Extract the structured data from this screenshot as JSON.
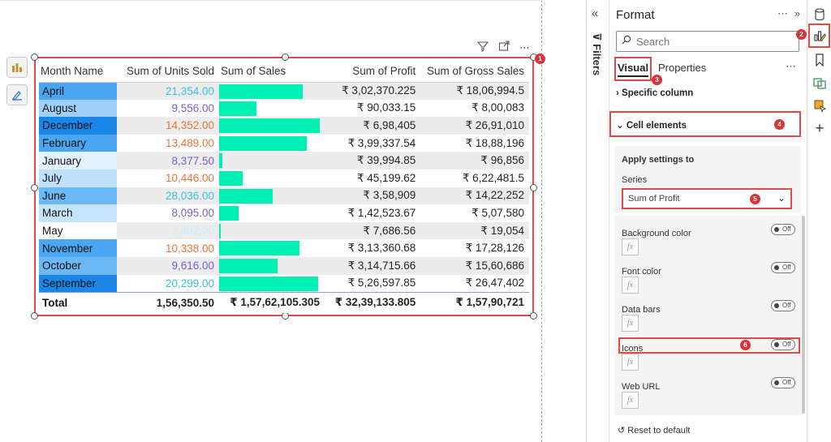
{
  "table": {
    "headers": [
      "Month Name",
      "Sum of Units Sold",
      "Sum of Sales",
      "Sum of Profit",
      "Sum of Gross Sales"
    ],
    "rows": [
      {
        "month": "April",
        "units": "21,354.00",
        "units_color": "#3ac1e8",
        "sales_fraction": 0.83,
        "profit": "₹ 3,02,370.225",
        "gross": "₹ 18,06,994.5",
        "month_bg": "#4aa6f0"
      },
      {
        "month": "August",
        "units": "9,556.00",
        "units_color": "#7a5fd1",
        "sales_fraction": 0.37,
        "profit": "₹ 90,033.15",
        "gross": "₹ 8,00,083",
        "month_bg": "#9fd0fb"
      },
      {
        "month": "December",
        "units": "14,352.00",
        "units_color": "#e8763a",
        "sales_fraction": 1.0,
        "profit": "₹ 6,98,405",
        "gross": "₹ 26,91,010",
        "month_bg": "#1a86e8"
      },
      {
        "month": "February",
        "units": "13,489.00",
        "units_color": "#e8763a",
        "sales_fraction": 0.87,
        "profit": "₹ 3,99,337.54",
        "gross": "₹ 18,88,196",
        "month_bg": "#4aa6f0"
      },
      {
        "month": "January",
        "units": "8,377.50",
        "units_color": "#7a5fd1",
        "sales_fraction": 0.03,
        "profit": "₹ 39,994.85",
        "gross": "₹ 96,856",
        "month_bg": "#e4f2fe"
      },
      {
        "month": "July",
        "units": "10,446.00",
        "units_color": "#e8763a",
        "sales_fraction": 0.23,
        "profit": "₹ 45,199.62",
        "gross": "₹ 6,22,481.5",
        "month_bg": "#bfe0fc"
      },
      {
        "month": "June",
        "units": "28,036.00",
        "units_color": "#3ac1e8",
        "sales_fraction": 0.53,
        "profit": "₹ 3,58,909",
        "gross": "₹ 14,22,252",
        "month_bg": "#6cb8f4"
      },
      {
        "month": "March",
        "units": "8,095.00",
        "units_color": "#7a5fd1",
        "sales_fraction": 0.19,
        "profit": "₹ 1,42,523.67",
        "gross": "₹ 5,07,580",
        "month_bg": "#c6e3fc"
      },
      {
        "month": "May",
        "units": "2,392.00",
        "units_color": "#c9ecf8",
        "sales_fraction": 0.02,
        "profit": "₹ 7,686.56",
        "gross": "₹ 19,054",
        "month_bg": "#ffffff"
      },
      {
        "month": "November",
        "units": "10,338.00",
        "units_color": "#e8763a",
        "sales_fraction": 0.8,
        "profit": "₹ 3,13,360.68",
        "gross": "₹ 17,28,126",
        "month_bg": "#4aa6f0"
      },
      {
        "month": "October",
        "units": "9,616.00",
        "units_color": "#7a5fd1",
        "sales_fraction": 0.58,
        "profit": "₹ 3,14,715.66",
        "gross": "₹ 15,60,686",
        "month_bg": "#6cb8f4"
      },
      {
        "month": "September",
        "units": "20,299.00",
        "units_color": "#3ac1e8",
        "sales_fraction": 0.98,
        "profit": "₹ 5,26,597.85",
        "gross": "₹ 26,47,402",
        "month_bg": "#1a86e8"
      }
    ],
    "total": {
      "label": "Total",
      "units": "1,56,350.50",
      "sales": "₹ 1,57,62,105.305",
      "profit": "₹ 32,39,133.805",
      "gross": "₹ 1,57,90,721"
    }
  },
  "filters_label": "Filters",
  "format": {
    "title": "Format",
    "search_placeholder": "Search",
    "tab_visual": "Visual",
    "tab_properties": "Properties",
    "specific_column": "Specific column",
    "cell_elements": "Cell elements",
    "apply_settings_to": "Apply settings to",
    "series_label": "Series",
    "series_value": "Sum of Profit",
    "settings": [
      {
        "name": "Background color",
        "state": "Off"
      },
      {
        "name": "Font color",
        "state": "Off"
      },
      {
        "name": "Data bars",
        "state": "Off"
      },
      {
        "name": "Icons",
        "state": "Off"
      },
      {
        "name": "Web URL",
        "state": "Off"
      }
    ],
    "reset": "Reset to default"
  },
  "badges": [
    "1",
    "2",
    "3",
    "4",
    "5",
    "6"
  ],
  "colors": {
    "accent_red": "#e04a4a",
    "data_bar": "#00f0b4"
  }
}
